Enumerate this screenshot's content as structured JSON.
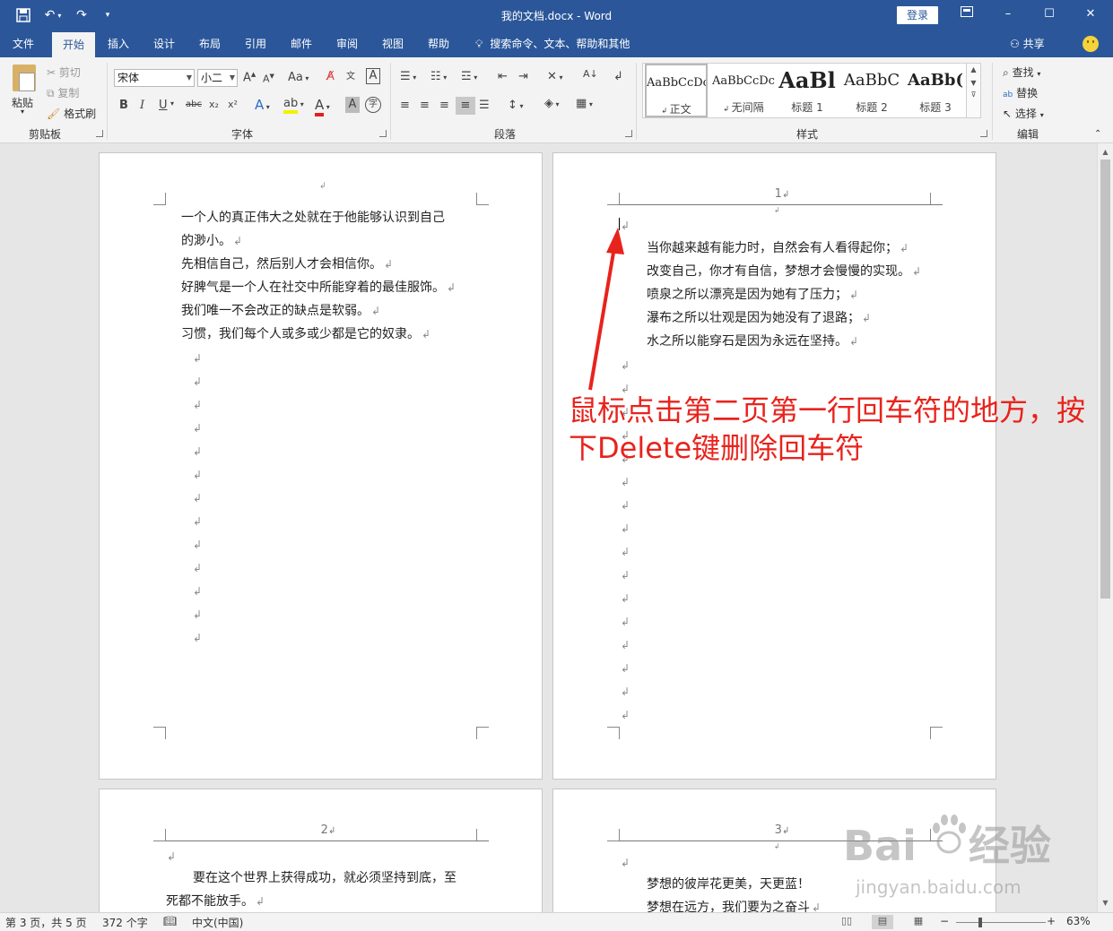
{
  "window": {
    "title": "我的文档.docx - Word",
    "login": "登录",
    "restore_icon": "ribbon-display-icon",
    "minimize": "–",
    "maximize": "☐",
    "close": "✕"
  },
  "menu": {
    "tabs": [
      "文件",
      "开始",
      "插入",
      "设计",
      "布局",
      "引用",
      "邮件",
      "审阅",
      "视图",
      "帮助"
    ],
    "active": "开始",
    "search": "搜索命令、文本、帮助和其他",
    "share": "共享"
  },
  "ribbon": {
    "clipboard": {
      "label": "剪贴板",
      "paste": "粘贴",
      "cut": "剪切",
      "copy": "复制",
      "format_painter": "格式刷"
    },
    "font": {
      "label": "字体",
      "font_name": "宋体",
      "font_size": "小二",
      "bold": "B",
      "italic": "I",
      "underline": "U",
      "strike": "abc",
      "sub": "x₂",
      "sup": "x²",
      "grow": "A",
      "shrink": "A",
      "case": "Aa"
    },
    "paragraph": {
      "label": "段落"
    },
    "styles": {
      "label": "样式",
      "items": [
        {
          "sample": "AaBbCcDc",
          "name": "正文"
        },
        {
          "sample": "AaBbCcDc",
          "name": "无间隔"
        },
        {
          "sample": "AaBl",
          "name": "标题 1"
        },
        {
          "sample": "AaBbC",
          "name": "标题 2"
        },
        {
          "sample": "AaBb(",
          "name": "标题 3"
        }
      ]
    },
    "editing": {
      "label": "编辑",
      "find": "查找",
      "replace": "替换",
      "select": "选择"
    }
  },
  "pages": {
    "p1_lines": [
      "一个人的真正伟大之处就在于他能够认识到自己",
      "的渺小。",
      "先相信自己，然后别人才会相信你。",
      "好脾气是一个人在社交中所能穿着的最佳服饰。",
      "我们唯一不会改正的缺点是软弱。",
      "习惯，我们每个人或多或少都是它的奴隶。"
    ],
    "p2_header": "1",
    "p2_lines": [
      "当你越来越有能力时，自然会有人看得起你；",
      "改变自己，你才有自信，梦想才会慢慢的实现。",
      "喷泉之所以漂亮是因为她有了压力；",
      "瀑布之所以壮观是因为她没有了退路；",
      "水之所以能穿石是因为永远在坚持。"
    ],
    "p3_header": "2",
    "p3_lines": [
      "要在这个世界上获得成功，就必须坚持到底，至",
      "死都不能放手。"
    ],
    "p4_header": "3",
    "p4_lines": [
      "梦想的彼岸花更美，天更蓝！",
      "梦想在远方，我们要为之奋斗"
    ]
  },
  "annotation": {
    "line1": "鼠标点击第二页第一行回车符的地方，按",
    "line2": "下Delete键删除回车符",
    "color": "#e8231c"
  },
  "status": {
    "page": "第 3 页，共 5 页",
    "words": "372 个字",
    "language": "中文(中国)",
    "zoom": "63%",
    "zoom_level": 0.63
  },
  "watermark": {
    "main": "Bai",
    "main2": "经验",
    "sub": "jingyan.baidu.com"
  }
}
